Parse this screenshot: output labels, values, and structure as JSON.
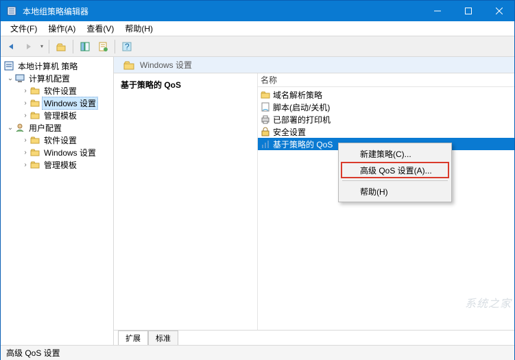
{
  "window": {
    "title": "本地组策略编辑器"
  },
  "menubar": {
    "file": "文件(F)",
    "action": "操作(A)",
    "view": "查看(V)",
    "help": "帮助(H)"
  },
  "tree": {
    "root": "本地计算机 策略",
    "computer": "计算机配置",
    "comp_software": "软件设置",
    "comp_windows": "Windows 设置",
    "comp_templates": "管理模板",
    "user": "用户配置",
    "user_software": "软件设置",
    "user_windows": "Windows 设置",
    "user_templates": "管理模板"
  },
  "pathbar": {
    "label": "Windows 设置"
  },
  "desc": {
    "title": "基于策略的 QoS"
  },
  "list": {
    "header": "名称",
    "items": [
      {
        "label": "域名解析策略"
      },
      {
        "label": "脚本(启动/关机)"
      },
      {
        "label": "已部署的打印机"
      },
      {
        "label": "安全设置"
      },
      {
        "label": "基于策略的 QoS"
      }
    ],
    "selected_index": 4
  },
  "tabs": {
    "extend": "扩展",
    "standard": "标准"
  },
  "statusbar": {
    "text": "高级 QoS 设置"
  },
  "context_menu": {
    "new_policy": "新建策略(C)...",
    "advanced": "高级 QoS 设置(A)...",
    "help": "帮助(H)"
  },
  "watermark": "系统之家"
}
